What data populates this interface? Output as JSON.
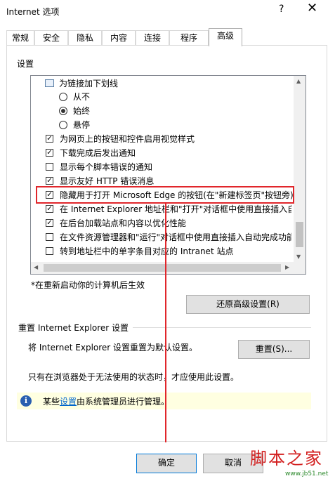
{
  "window": {
    "title": "Internet 选项",
    "help_label": "?",
    "close_label": "✕"
  },
  "tabs": [
    {
      "label": "常规"
    },
    {
      "label": "安全"
    },
    {
      "label": "隐私"
    },
    {
      "label": "内容"
    },
    {
      "label": "连接"
    },
    {
      "label": "程序"
    },
    {
      "label": "高级",
      "active": true
    }
  ],
  "settings": {
    "label": "设置",
    "items": [
      {
        "type": "group",
        "label": "为链接加下划线",
        "icon": "settings-group-icon"
      },
      {
        "type": "radio",
        "label": "从不",
        "checked": false
      },
      {
        "type": "radio",
        "label": "始终",
        "checked": true
      },
      {
        "type": "radio",
        "label": "悬停",
        "checked": false
      },
      {
        "type": "checkbox",
        "label": "为网页上的按钮和控件启用视觉样式",
        "checked": true
      },
      {
        "type": "checkbox",
        "label": "下载完成后发出通知",
        "checked": true
      },
      {
        "type": "checkbox",
        "label": "显示每个脚本错误的通知",
        "checked": false
      },
      {
        "type": "checkbox",
        "label": "显示友好 HTTP 错误消息",
        "checked": true
      },
      {
        "type": "checkbox",
        "label": "隐藏用于打开 Microsoft Edge 的按钮(在\"新建标签页\"按钮旁)",
        "checked": true,
        "highlighted": true
      },
      {
        "type": "checkbox",
        "label": "在 Internet Explorer 地址栏和\"打开\"对话框中使用直接插入自",
        "checked": true
      },
      {
        "type": "checkbox",
        "label": "在后台加载站点和内容以优化性能",
        "checked": true
      },
      {
        "type": "checkbox",
        "label": "在文件资源管理器和\"运行\"对话框中使用直接插入自动完成功能",
        "checked": false
      },
      {
        "type": "checkbox",
        "label": "转到地址栏中的单字条目对应的 Intranet 站点",
        "checked": false
      }
    ],
    "restart_note": "*在重新启动你的计算机后生效",
    "restore_button": "还原高级设置(R)"
  },
  "reset": {
    "title": "重置 Internet Explorer 设置",
    "description": "将 Internet Explorer 设置重置为默认设置。",
    "button": "重置(S)...",
    "note": "只有在浏览器处于无法使用的状态时，才应使用此设置。"
  },
  "info": {
    "icon_glyph": "i",
    "text_before": "某些",
    "link": "设置",
    "text_after": "由系统管理员进行管理。"
  },
  "footer": {
    "ok": "确定",
    "cancel": "取消"
  },
  "watermark": {
    "text": "脚本之家",
    "url": "www.jb51.net"
  },
  "colors": {
    "highlight": "#e1262b",
    "info_bar": "#ffffe1",
    "link": "#0066cc"
  }
}
